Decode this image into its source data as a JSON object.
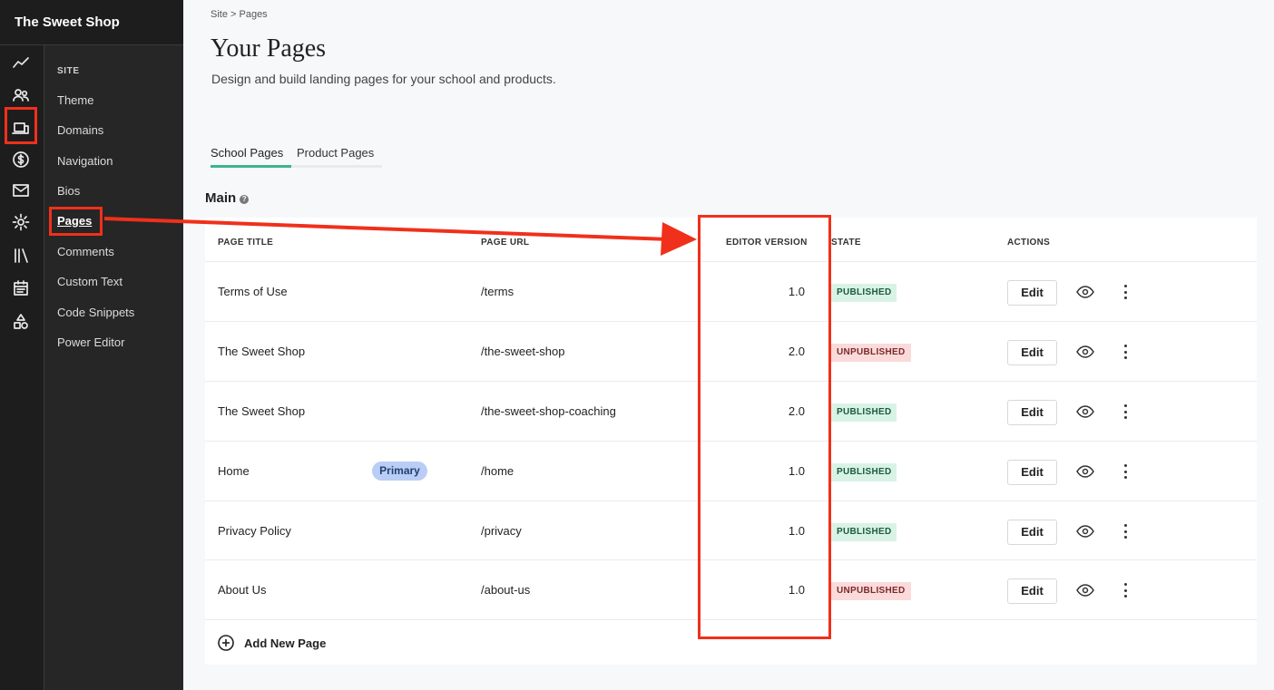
{
  "brand": "The Sweet Shop",
  "rail_icons": [
    "analytics-icon",
    "users-icon",
    "site-devices-icon",
    "sales-icon",
    "email-icon",
    "settings-icon",
    "library-icon",
    "calendar-icon",
    "shapes-icon"
  ],
  "subnav": {
    "heading": "SITE",
    "items": [
      "Theme",
      "Domains",
      "Navigation",
      "Bios",
      "Pages",
      "Comments",
      "Custom Text",
      "Code Snippets",
      "Power Editor"
    ],
    "active": "Pages"
  },
  "breadcrumb": "Site > Pages",
  "title": "Your Pages",
  "subtitle": "Design and build landing pages for your school and products.",
  "tabs": [
    "School Pages",
    "Product Pages"
  ],
  "section": "Main",
  "columns": {
    "title": "PAGE TITLE",
    "url": "PAGE URL",
    "version": "EDITOR VERSION",
    "state": "STATE",
    "actions": "ACTIONS"
  },
  "rows": [
    {
      "title": "Terms of Use",
      "url": "/terms",
      "version": "1.0",
      "state": "PUBLISHED"
    },
    {
      "title": "The Sweet Shop",
      "url": "/the-sweet-shop",
      "version": "2.0",
      "state": "UNPUBLISHED"
    },
    {
      "title": "The Sweet Shop",
      "url": "/the-sweet-shop-coaching",
      "version": "2.0",
      "state": "PUBLISHED"
    },
    {
      "title": "Home",
      "badge": "Primary",
      "url": "/home",
      "version": "1.0",
      "state": "PUBLISHED"
    },
    {
      "title": "Privacy Policy",
      "url": "/privacy",
      "version": "1.0",
      "state": "PUBLISHED"
    },
    {
      "title": "About Us",
      "url": "/about-us",
      "version": "1.0",
      "state": "UNPUBLISHED"
    }
  ],
  "edit_label": "Edit",
  "add_label": "Add New Page",
  "colors": {
    "sidebar": "#1d1d1d",
    "tab_active": "#3bb58a",
    "published_bg": "#d8f3e6",
    "unpublished_bg": "#fbdada",
    "primary_badge": "#b9cdf6",
    "annotation": "#f0301b"
  }
}
